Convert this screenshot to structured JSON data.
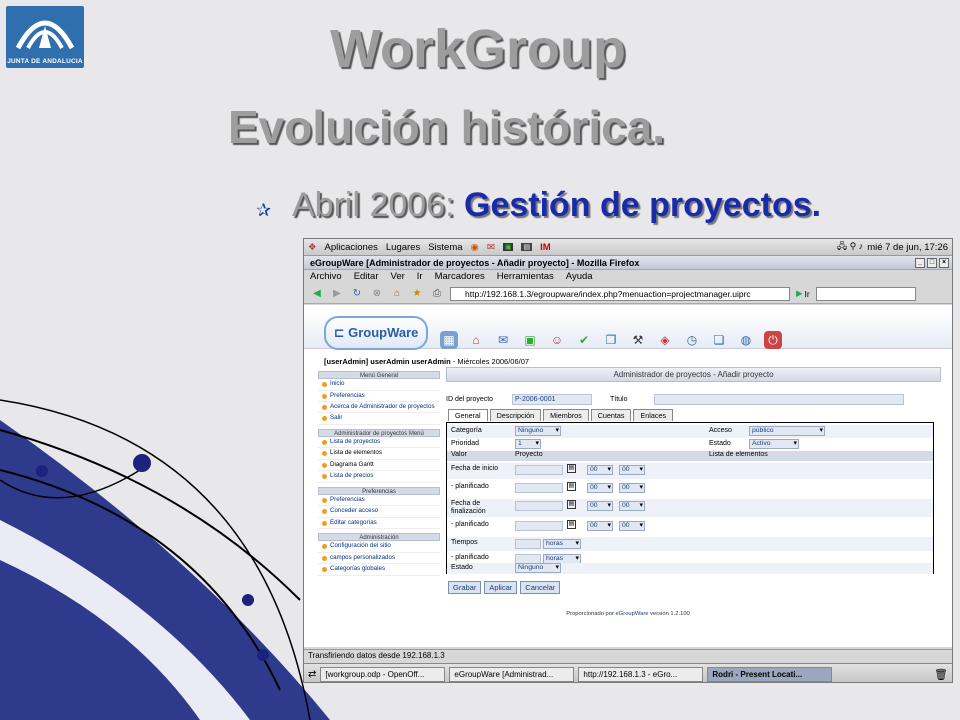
{
  "slide": {
    "logo_text": "JUNTA DE ANDALUCIA",
    "title_line1": "WorkGroup",
    "title_line2": "Evolución histórica.",
    "bullet_prefix": "Abril 2006: ",
    "bullet_main": "Gestión de proyectos",
    "bullet_suffix": "."
  },
  "gnome_panel": {
    "menus": [
      "Aplicaciones",
      "Lugares",
      "Sistema"
    ],
    "clock": "mié  7 de jun, 17:26"
  },
  "window": {
    "title": "eGroupWare [Administrador de proyectos - Añadir proyecto] - Mozilla Firefox"
  },
  "menubar": [
    "Archivo",
    "Editar",
    "Ver",
    "Ir",
    "Marcadores",
    "Herramientas",
    "Ayuda"
  ],
  "navbar": {
    "url": "http://192.168.1.3/egroupware/index.php?menuaction=projectmanager.uiprc",
    "go_label": "Ir"
  },
  "egw": {
    "brand": "GroupWare",
    "user_prefix": "[userAdmin] userAdmin userAdmin",
    "user_date": " - Miércoles 2006/06/07",
    "sidebar": [
      {
        "head": "Menú General",
        "items": [
          {
            "label": "Inicio"
          },
          {
            "label": "Preferencias"
          },
          {
            "label": "Acerca de Administrador de proyectos"
          },
          {
            "label": "Salir"
          }
        ]
      },
      {
        "head": "Administrador de proyectos Menú",
        "items": [
          {
            "label": "Lista de proyectos"
          },
          {
            "label": "Lista de elementos",
            "black": true
          },
          {
            "label": "Diagrama Gantt",
            "black": true
          },
          {
            "label": "Lista de precios"
          }
        ]
      },
      {
        "head": "Preferencias",
        "items": [
          {
            "label": "Preferencias"
          },
          {
            "label": "Conceder acceso"
          },
          {
            "label": "Editar categorías"
          }
        ]
      },
      {
        "head": "Administración",
        "items": [
          {
            "label": "Configuración del sitio"
          },
          {
            "label": "campos personalizados"
          },
          {
            "label": "Categorías globales"
          }
        ]
      }
    ],
    "panel_title": "Administrador de proyectos - Añadir proyecto",
    "id_label": "ID del proyecto",
    "id_value": "P-2006-0001",
    "titulo_label": "Título",
    "tabs": [
      "General",
      "Descripción",
      "Miembros",
      "Cuentas",
      "Enlaces"
    ],
    "form": {
      "categoria_label": "Categoría",
      "categoria_value": "Ninguno",
      "acceso_label": "Acceso",
      "acceso_value": "público",
      "prioridad_label": "Prioridad",
      "prioridad_value": "1",
      "estado_label": "Estado",
      "estado_value": "Activo",
      "valor_label": "Valor",
      "proyecto_label": "Proyecto",
      "lista_label": "Lista de elementos",
      "fecha_inicio_label": "Fecha de inicio",
      "planificado_label": "- planificado",
      "fecha_final_label1": "Fecha de",
      "fecha_final_label2": "finalización",
      "tiempos_label": "Tiempos",
      "estado2_label": "Estado",
      "estado2_value": "Ninguno",
      "hour_value": "00",
      "minute_value": "00",
      "horas_value": "horas"
    },
    "buttons": [
      "Grabar",
      "Aplicar",
      "Cancelar"
    ],
    "credit_prefix": "Proporcionado por ",
    "credit_brand": "eGroupWare",
    "credit_suffix": " versión 1.2.100"
  },
  "statusbar": "Transfiriendo datos desde 192.168.1.3",
  "taskbar": [
    "[workgroup.odp - OpenOff...",
    "eGroupWare [Administrad...",
    "http://192.168.1.3 - eGro...",
    "Rodri - Present Locati..."
  ]
}
